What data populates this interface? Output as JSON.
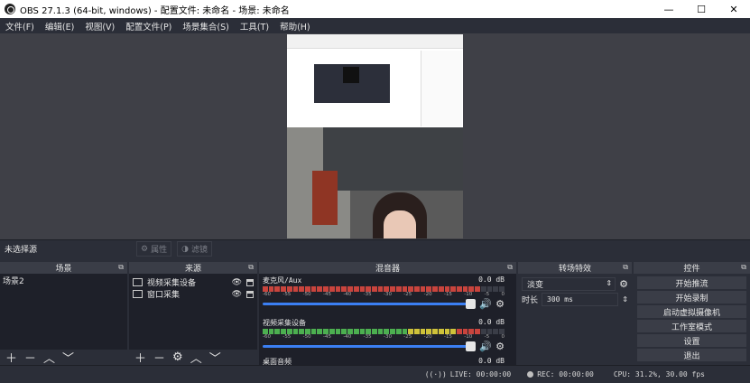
{
  "window": {
    "title": "OBS 27.1.3 (64-bit, windows) - 配置文件: 未命名 - 场景: 未命名",
    "minimize": "—",
    "maximize": "☐",
    "close": "✕"
  },
  "menu": [
    "文件(F)",
    "编辑(E)",
    "视图(V)",
    "配置文件(P)",
    "场景集合(S)",
    "工具(T)",
    "帮助(H)"
  ],
  "source_toolbar": {
    "no_selection": "未选择源",
    "properties": "属性",
    "filters": "滤镜"
  },
  "docks": {
    "scenes": {
      "title": "场景",
      "items": [
        "场景2"
      ]
    },
    "sources": {
      "title": "来源",
      "items": [
        "视频采集设备",
        "窗口采集"
      ]
    },
    "mixer": {
      "title": "混音器",
      "channels": [
        {
          "name": "麦克风/Aux",
          "level": "0.0 dB",
          "fill": 0.88
        },
        {
          "name": "视频采集设备",
          "level": "0.0 dB",
          "fill": 0.88
        },
        {
          "name": "桌面音频",
          "level": "0.0 dB",
          "fill": 0.88
        }
      ],
      "ticks": [
        "-60",
        "-55",
        "-50",
        "-45",
        "-40",
        "-35",
        "-30",
        "-25",
        "-20",
        "-15",
        "-10",
        "-5",
        "0"
      ]
    },
    "transitions": {
      "title": "转场特效",
      "selected": "淡变",
      "duration_label": "时长",
      "duration_value": "300 ms"
    },
    "controls": {
      "title": "控件",
      "buttons": [
        "开始推流",
        "开始录制",
        "启动虚拟摄像机",
        "工作室模式",
        "设置",
        "退出"
      ]
    }
  },
  "status": {
    "live": "LIVE: 00:00:00",
    "rec": "REC: 00:00:00",
    "cpu": "CPU: 31.2%, 30.00 fps"
  },
  "colors": {
    "bg": "#2b2e38",
    "panel": "#1e2029",
    "header": "#3a3d47",
    "meter_red": "#c9443d",
    "meter_green": "#4caf50",
    "meter_yellow": "#cfc23a",
    "fader": "#3b7ff3"
  }
}
